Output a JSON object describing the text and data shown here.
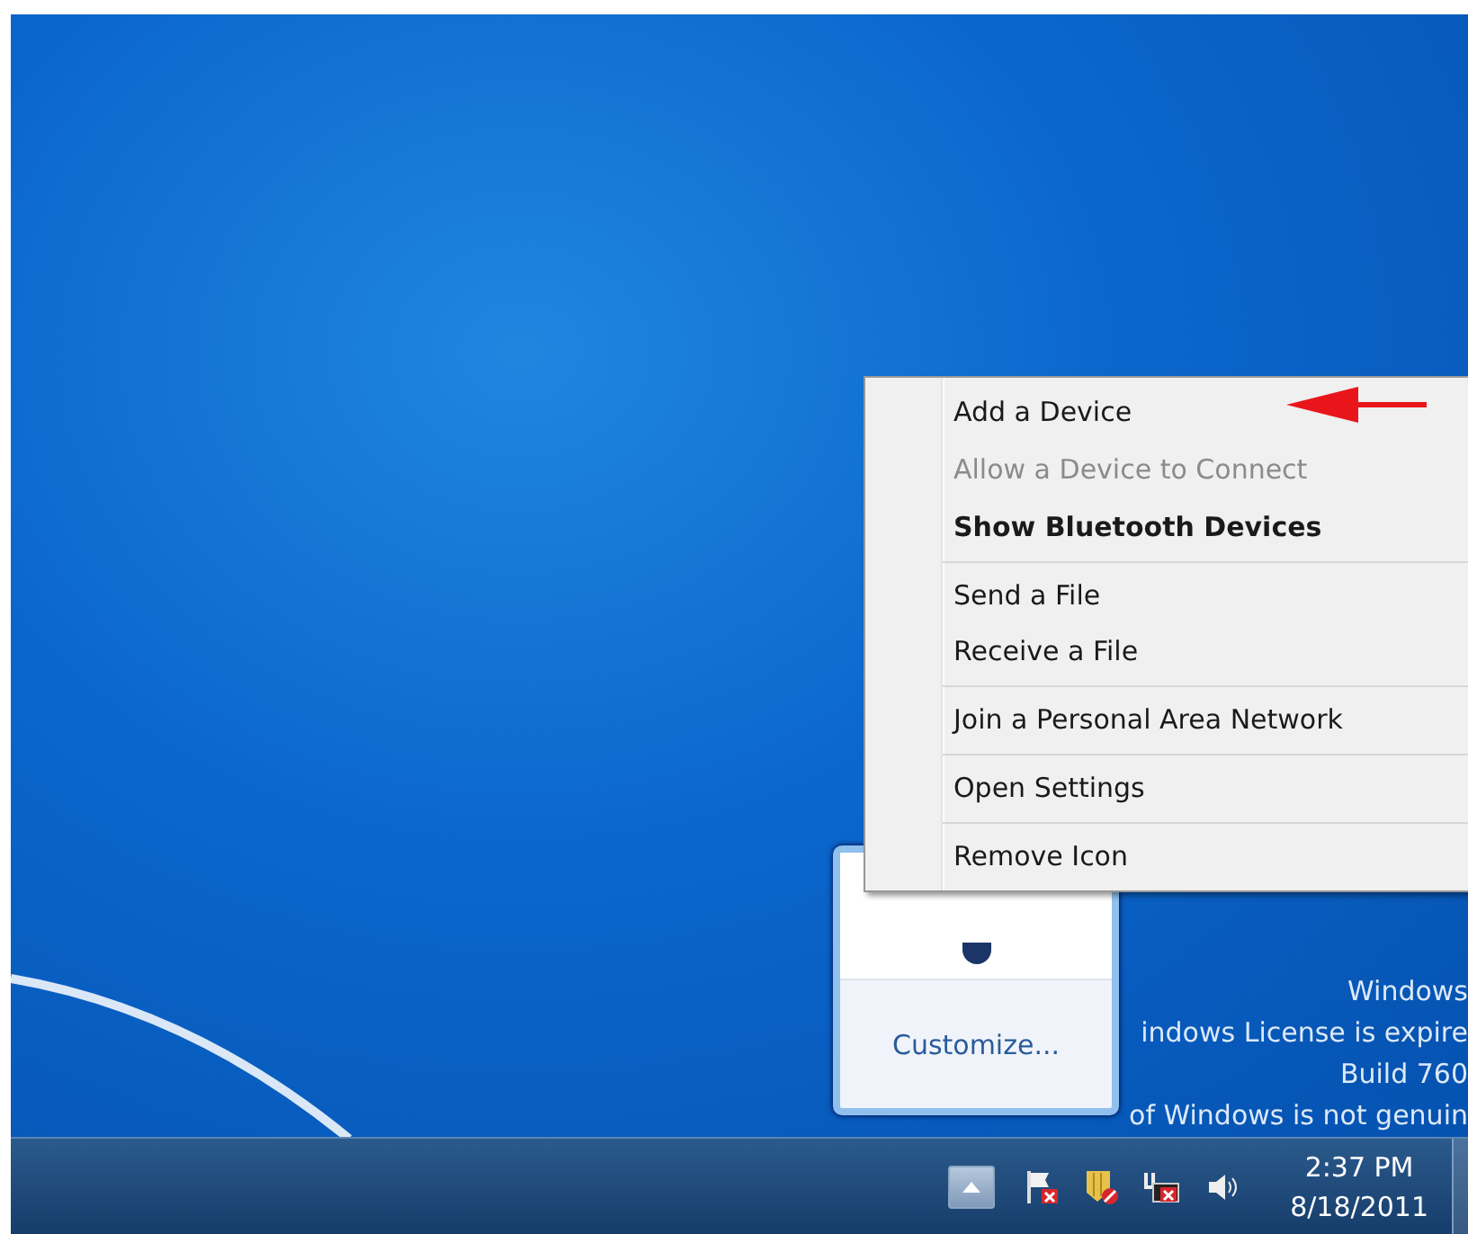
{
  "desktop_text": [
    "Windows",
    "indows License is expire",
    "Build 760",
    "of Windows is not genuin"
  ],
  "overflow_popup": {
    "link": "Customize..."
  },
  "context_menu": {
    "groups": [
      {
        "items": [
          {
            "label": "Add a Device",
            "disabled": false,
            "default": false
          },
          {
            "label": "Allow a Device to Connect",
            "disabled": true,
            "default": false
          },
          {
            "label": "Show Bluetooth Devices",
            "disabled": false,
            "default": true
          }
        ]
      },
      {
        "items": [
          {
            "label": "Send a File",
            "disabled": false,
            "default": false
          },
          {
            "label": "Receive a File",
            "disabled": false,
            "default": false
          }
        ]
      },
      {
        "items": [
          {
            "label": "Join a Personal Area Network",
            "disabled": false,
            "default": false
          }
        ]
      },
      {
        "items": [
          {
            "label": "Open Settings",
            "disabled": false,
            "default": false
          }
        ]
      },
      {
        "items": [
          {
            "label": "Remove Icon",
            "disabled": false,
            "default": false
          }
        ]
      }
    ]
  },
  "taskbar": {
    "time": "2:37 PM",
    "date": "8/18/2011"
  }
}
